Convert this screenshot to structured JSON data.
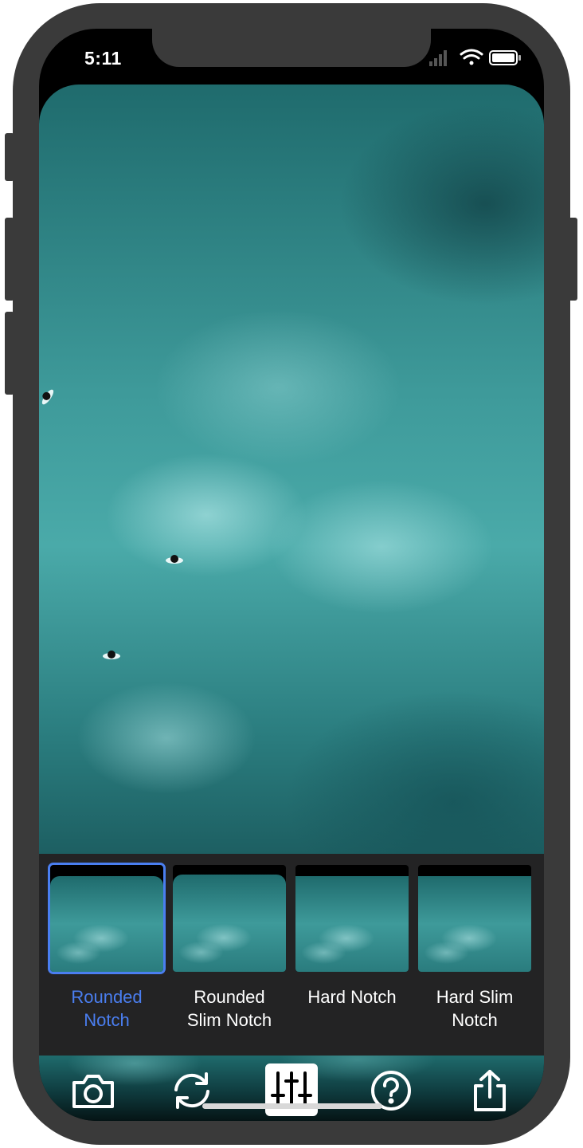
{
  "status_bar": {
    "time": "5:11",
    "icons": [
      "cellular-signal-icon",
      "wifi-icon",
      "battery-icon"
    ]
  },
  "main_image": {
    "description_icon": "ocean-aerial-photo"
  },
  "notch_styles": [
    {
      "label": "Rounded\nNotch",
      "selected": true
    },
    {
      "label": "Rounded\nSlim Notch",
      "selected": false
    },
    {
      "label": "Hard Notch",
      "selected": false
    },
    {
      "label": "Hard Slim\nNotch",
      "selected": false
    }
  ],
  "toolbar": {
    "items": [
      "camera-icon",
      "refresh-icon",
      "sliders-icon",
      "help-icon",
      "share-icon"
    ],
    "active": "sliders-icon"
  },
  "colors": {
    "accent": "#4a7ef0",
    "frame": "#3a3a3a",
    "picker_bg": "#232324"
  }
}
